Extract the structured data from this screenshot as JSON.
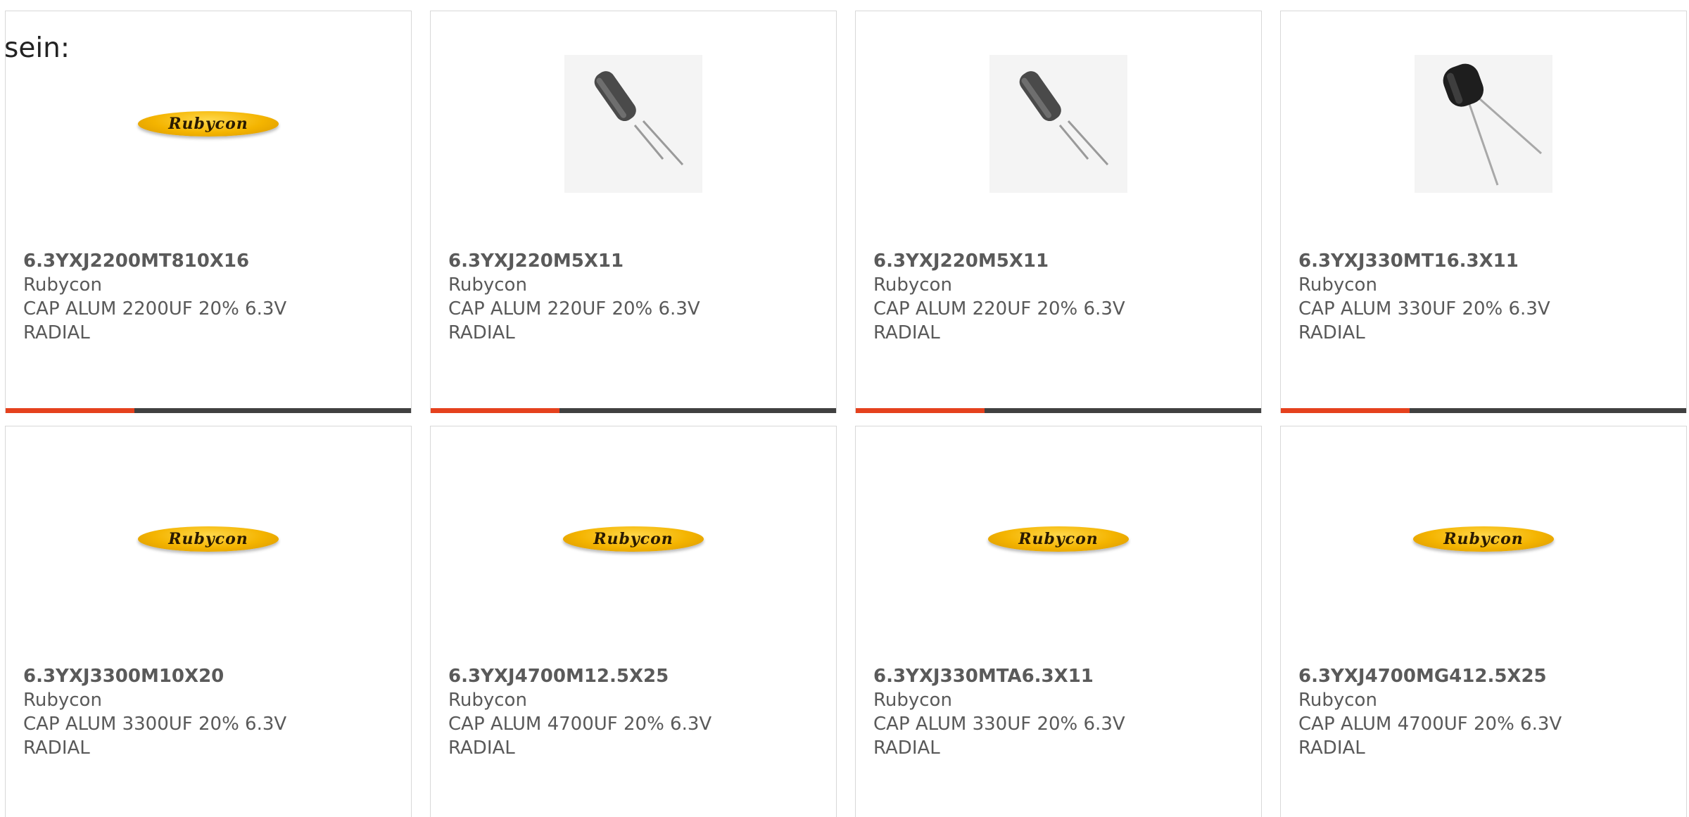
{
  "intro_text": "sein:",
  "brand_logo_text": "Rubycon",
  "products": [
    {
      "part_number": "6.3YXJ2200MT810X16",
      "manufacturer": "Rubycon",
      "desc_line1": "CAP ALUM 2200UF 20% 6.3V",
      "desc_line2": "RADIAL",
      "image": "brand-logo"
    },
    {
      "part_number": "6.3YXJ220M5X11",
      "manufacturer": "Rubycon",
      "desc_line1": "CAP ALUM 220UF 20% 6.3V",
      "desc_line2": "RADIAL",
      "image": "capacitor-photo-slim"
    },
    {
      "part_number": "6.3YXJ220M5X11",
      "manufacturer": "Rubycon",
      "desc_line1": "CAP ALUM 220UF 20% 6.3V",
      "desc_line2": "RADIAL",
      "image": "capacitor-photo-slim"
    },
    {
      "part_number": "6.3YXJ330MT16.3X11",
      "manufacturer": "Rubycon",
      "desc_line1": "CAP ALUM 330UF 20% 6.3V",
      "desc_line2": "RADIAL",
      "image": "capacitor-photo-short"
    },
    {
      "part_number": "6.3YXJ3300M10X20",
      "manufacturer": "Rubycon",
      "desc_line1": "CAP ALUM 3300UF 20% 6.3V",
      "desc_line2": "RADIAL",
      "image": "brand-logo"
    },
    {
      "part_number": "6.3YXJ4700M12.5X25",
      "manufacturer": "Rubycon",
      "desc_line1": "CAP ALUM 4700UF 20% 6.3V",
      "desc_line2": "RADIAL",
      "image": "brand-logo"
    },
    {
      "part_number": "6.3YXJ330MTA6.3X11",
      "manufacturer": "Rubycon",
      "desc_line1": "CAP ALUM 330UF 20% 6.3V",
      "desc_line2": "RADIAL",
      "image": "brand-logo"
    },
    {
      "part_number": "6.3YXJ4700MG412.5X25",
      "manufacturer": "Rubycon",
      "desc_line1": "CAP ALUM 4700UF 20% 6.3V",
      "desc_line2": "RADIAL",
      "image": "brand-logo"
    }
  ],
  "colors": {
    "accent": "#e5411d",
    "bar": "#404040",
    "card_border": "#d8d8d8",
    "text": "#595959"
  }
}
